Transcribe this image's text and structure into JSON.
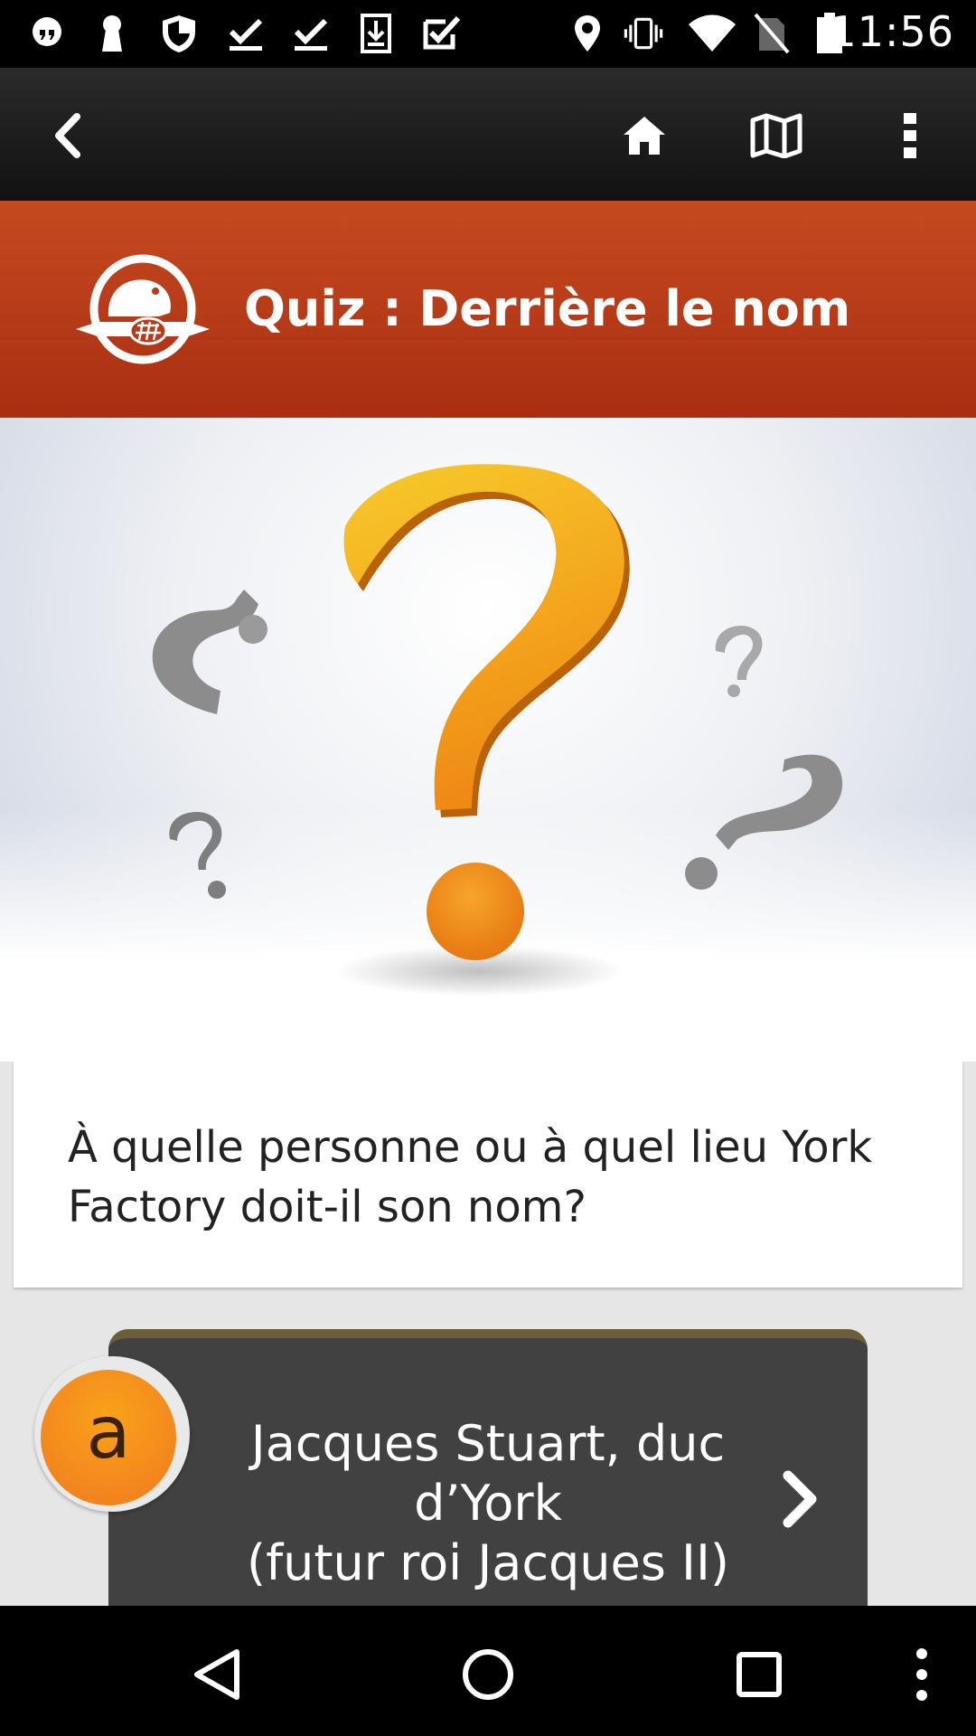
{
  "status_bar": {
    "time": "11:56",
    "left_icons": [
      "hangouts-icon",
      "keyhole-icon",
      "shield-icon",
      "download-done-icon",
      "download-done-icon",
      "download-icon",
      "checkbox-icon"
    ],
    "right_icons": [
      "location-icon",
      "vibrate-icon",
      "wifi-icon",
      "no-sim-icon",
      "battery-icon"
    ]
  },
  "action_bar": {
    "icons": [
      "back-icon",
      "home-icon",
      "map-icon",
      "overflow-menu-icon"
    ]
  },
  "banner": {
    "title": "Quiz : Derrière le nom",
    "logo": "parks-canada-beaver-logo",
    "color": "#b83a18"
  },
  "question": {
    "text": "À quelle personne ou à quel lieu York Factory doit-il son nom?"
  },
  "answer": {
    "badge": "a",
    "text": "Jacques Stuart, duc\nd’York\n(futur roi Jacques II)",
    "chevron": "chevron-right-icon"
  },
  "nav_bar": {
    "icons": [
      "nav-back-icon",
      "nav-home-icon",
      "nav-recents-icon",
      "nav-menu-icon"
    ]
  }
}
